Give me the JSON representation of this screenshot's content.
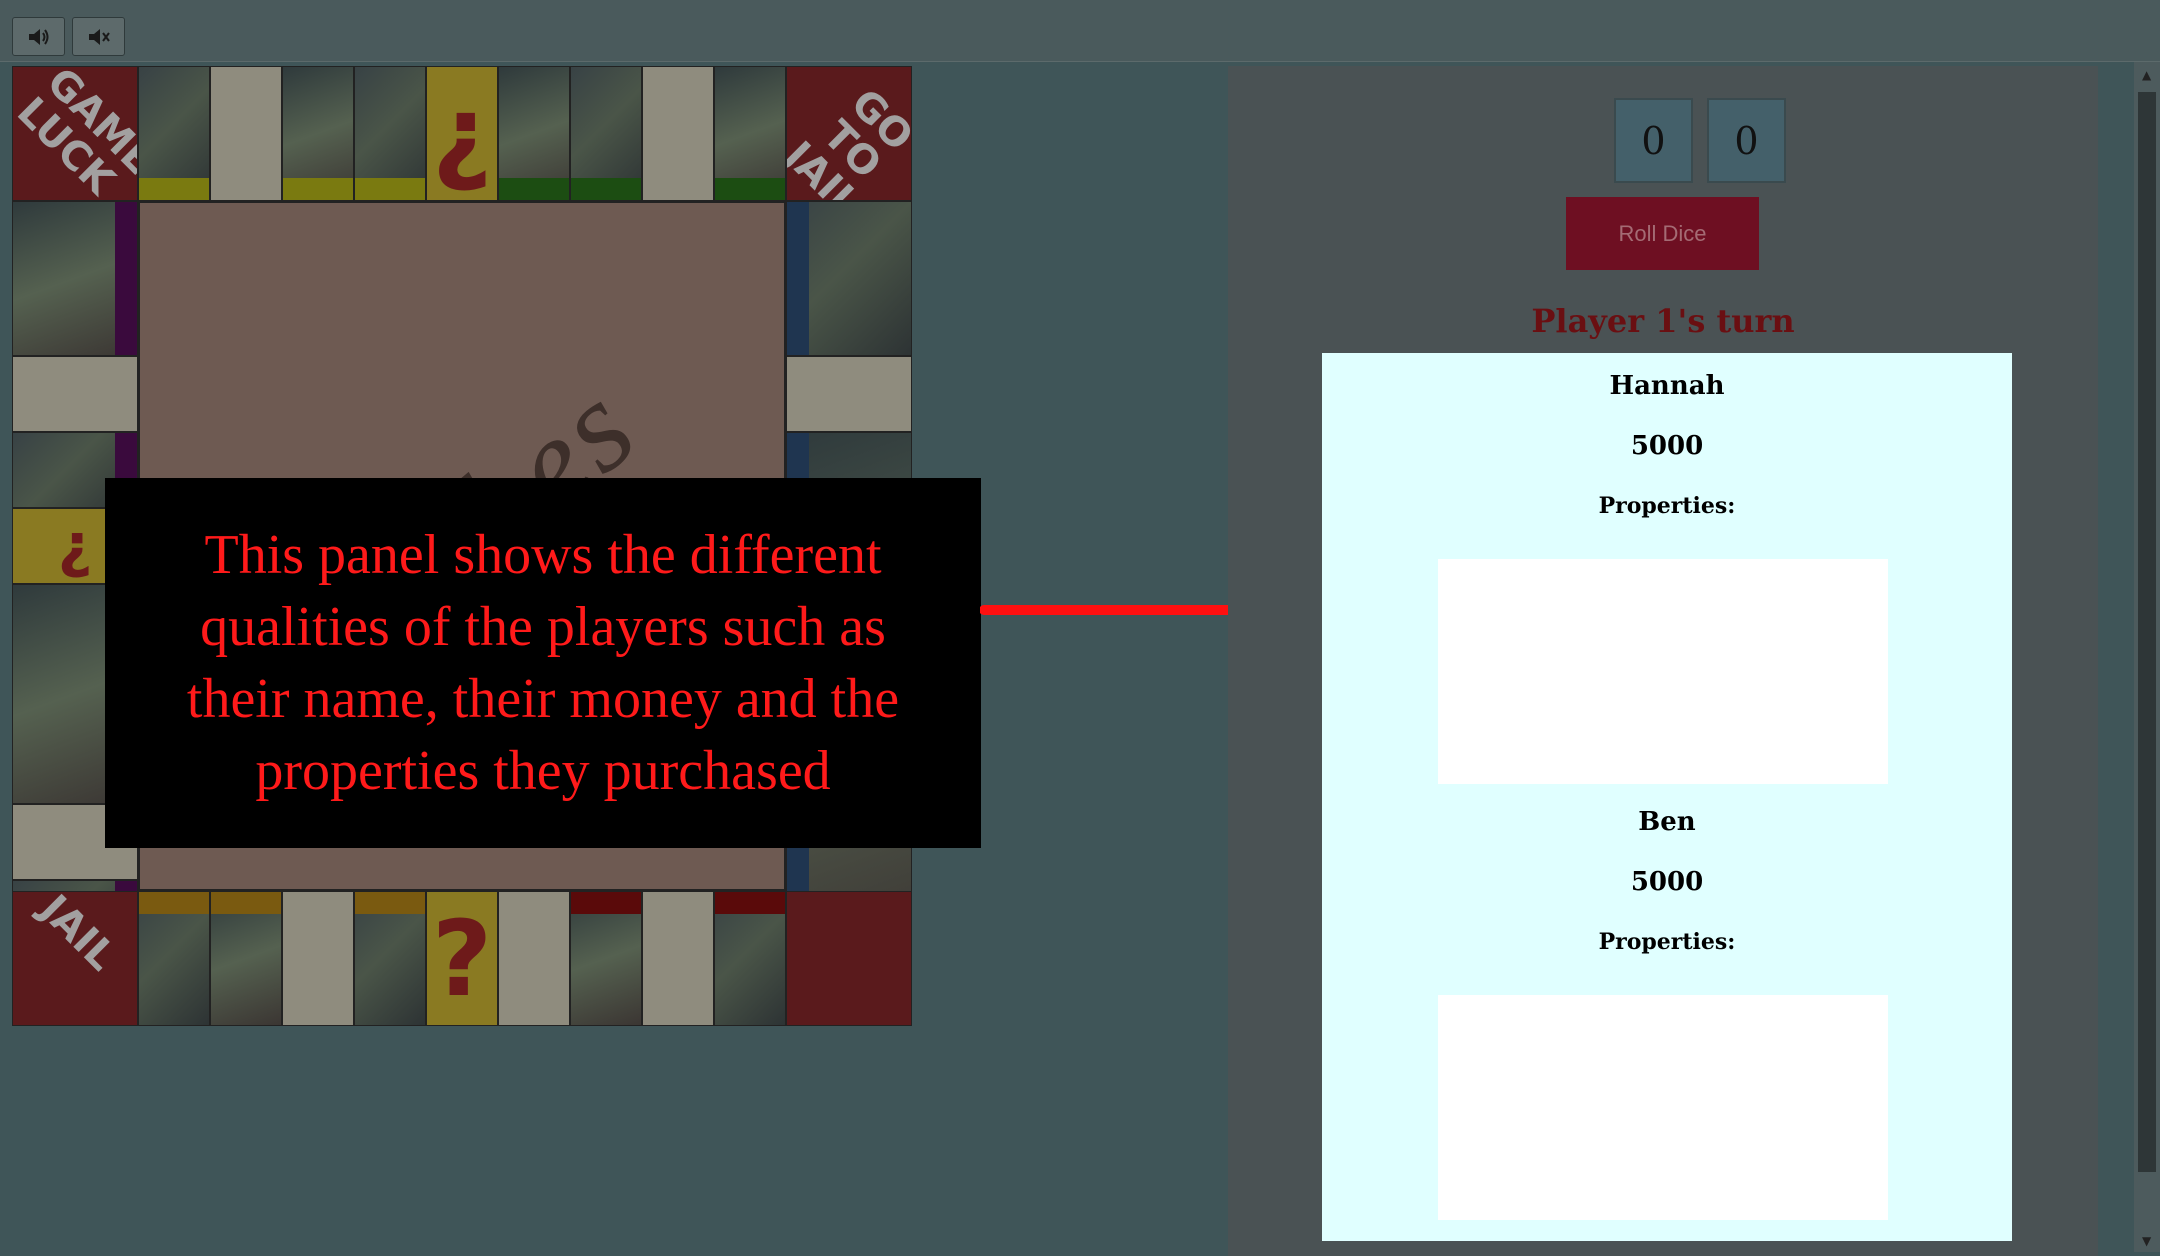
{
  "toolbar": {
    "sound_on_icon": "speaker-on-icon",
    "sound_off_icon": "speaker-mute-icon"
  },
  "board": {
    "corners": {
      "top_left": "GAME LUCK",
      "top_right": "GO TO JAIL",
      "bottom_left": "JAIL"
    },
    "center_logo": "Riches",
    "chance_symbol_top": "¿",
    "chance_symbol_bottom": "?",
    "chance_symbol_left": "¿"
  },
  "annotation": {
    "text": "This panel shows the different qualities of the players such as their name, their money and the properties they purchased"
  },
  "panel": {
    "dice": [
      "0",
      "0"
    ],
    "roll_button": "Roll Dice",
    "turn_label": "Player 1's turn",
    "players": [
      {
        "name": "Hannah",
        "money": "5000",
        "properties_label": "Properties:"
      },
      {
        "name": "Ben",
        "money": "5000",
        "properties_label": "Properties:"
      }
    ]
  },
  "colors": {
    "accent_red": "#ff1a1a",
    "roll_button_bg": "#6e0f22",
    "player_panel_bg": "#e0ffff"
  }
}
